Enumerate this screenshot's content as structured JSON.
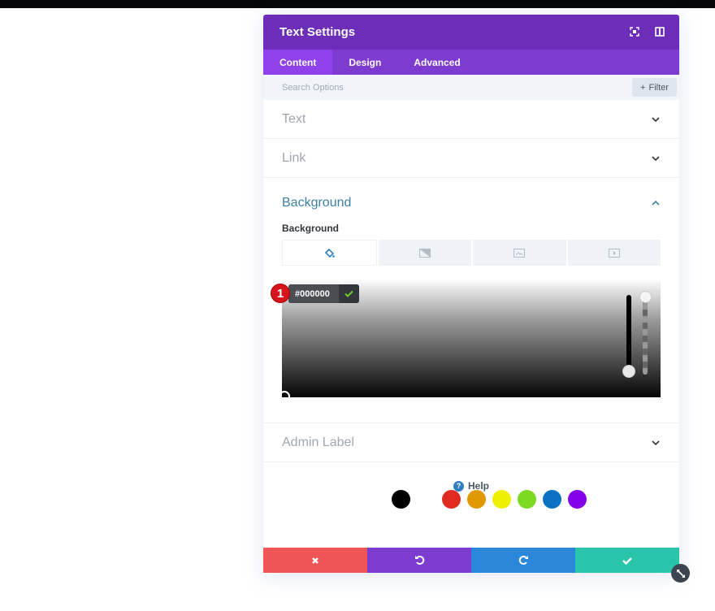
{
  "header": {
    "title": "Text Settings",
    "icons": [
      "focus-mode-icon",
      "sidebar-toggle-icon"
    ]
  },
  "tabs": [
    {
      "label": "Content",
      "active": true
    },
    {
      "label": "Design",
      "active": false
    },
    {
      "label": "Advanced",
      "active": false
    }
  ],
  "search": {
    "placeholder": "Search Options",
    "value": "",
    "filter_label": "Filter"
  },
  "sections": {
    "text": {
      "title": "Text",
      "open": false
    },
    "link": {
      "title": "Link",
      "open": false
    },
    "background": {
      "title": "Background",
      "open": true,
      "field_label": "Background",
      "type_tabs": [
        {
          "icon": "paint-bucket-icon",
          "active": true
        },
        {
          "icon": "gradient-icon",
          "active": false
        },
        {
          "icon": "image-icon",
          "active": false
        },
        {
          "icon": "video-icon",
          "active": false
        }
      ],
      "color_picker": {
        "hex_value": "#000000",
        "badge_number": "1",
        "swatches": [
          "#000000",
          "#ffffff",
          "#e02b20",
          "#e09900",
          "#edf000",
          "#7cda24",
          "#0c71c3",
          "#8300e9"
        ]
      }
    },
    "admin_label": {
      "title": "Admin Label",
      "open": false
    }
  },
  "help": {
    "label": "Help"
  },
  "footer": {
    "buttons": [
      {
        "name": "cancel",
        "icon": "close-icon",
        "color": "#ef5555"
      },
      {
        "name": "undo",
        "icon": "undo-icon",
        "color": "#7e3bd0"
      },
      {
        "name": "redo",
        "icon": "redo-icon",
        "color": "#2b87da"
      },
      {
        "name": "save",
        "icon": "check-icon",
        "color": "#29c4a9"
      }
    ]
  },
  "colors": {
    "header": "#6c2eb9",
    "tabs": "#7e3bd0",
    "active_tab": "#8f42ec",
    "section_open_title": "#3e7fa5"
  }
}
